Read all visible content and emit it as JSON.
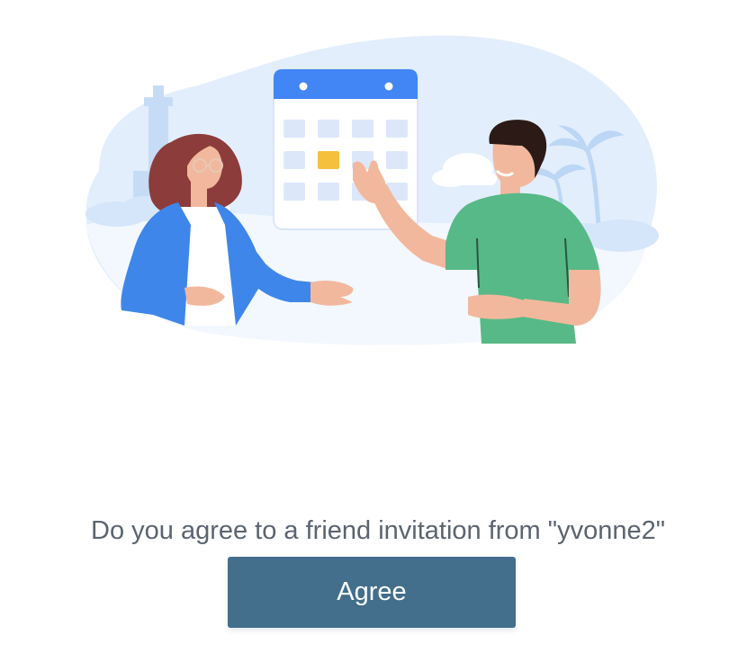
{
  "invitation": {
    "message": "Do you agree to a friend invitation from \"yvonne2\"",
    "agree_label": "Agree"
  },
  "illustration": {
    "name": "friends-calendar-illustration"
  },
  "colors": {
    "button_bg": "#436e8c",
    "button_text": "#ffffff",
    "text": "#5b6470",
    "calendar_header": "#4285f4",
    "calendar_highlight": "#f5c03b",
    "man_shirt": "#57b987",
    "woman_jacket": "#3f86ea"
  }
}
